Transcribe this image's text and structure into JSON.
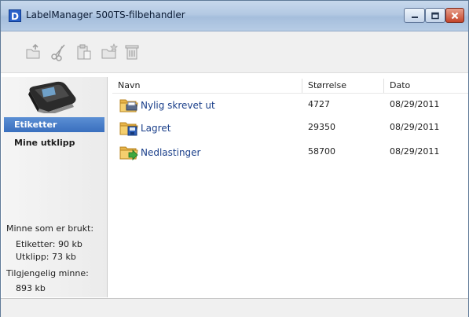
{
  "window": {
    "title": "LabelManager 500TS-filbehandler",
    "app_icon_glyph": "D",
    "accent": "#3a6fbe"
  },
  "toolbar": {
    "buttons": [
      {
        "icon": "new-folder-up-icon"
      },
      {
        "icon": "cut-scissors-icon"
      },
      {
        "icon": "paste-clipboard-icon"
      },
      {
        "icon": "folder-star-icon"
      },
      {
        "icon": "delete-trash-icon"
      }
    ]
  },
  "sidebar": {
    "items": [
      {
        "label": "Etiketter",
        "selected": true
      },
      {
        "label": "Mine utklipp",
        "selected": false
      }
    ],
    "memory": {
      "used_heading": "Minne som er brukt:",
      "labels_used": "Etiketter: 90 kb",
      "clips_used": "Utklipp: 73 kb",
      "available_heading": "Tilgjengelig minne:",
      "available_value": "893 kb"
    }
  },
  "table": {
    "columns": [
      "Navn",
      "Størrelse",
      "Dato"
    ],
    "rows": [
      {
        "name": "Nylig skrevet ut",
        "size": "4727",
        "date": "08/29/2011",
        "icon": "folder-printer-icon"
      },
      {
        "name": "Lagret",
        "size": "29350",
        "date": "08/29/2011",
        "icon": "folder-save-icon"
      },
      {
        "name": "Nedlastinger",
        "size": "58700",
        "date": "08/29/2011",
        "icon": "folder-download-icon"
      }
    ]
  }
}
